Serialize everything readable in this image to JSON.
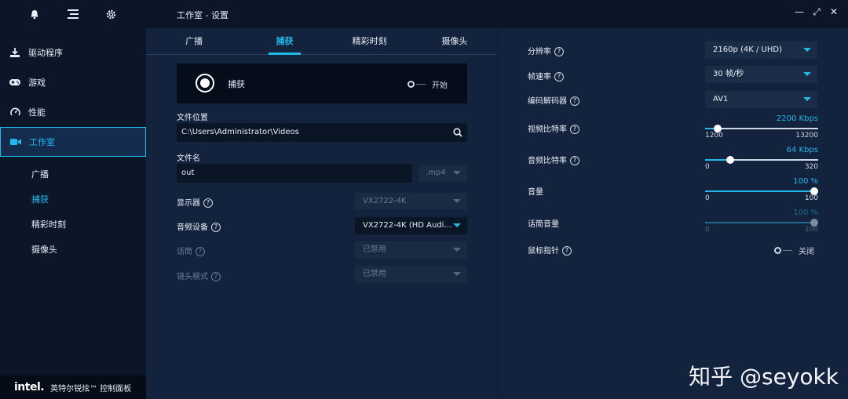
{
  "sidebar": {
    "top_icons": [
      "bell-icon",
      "menu-list-icon",
      "gear-icon"
    ],
    "items": [
      {
        "label": "驱动程序",
        "icon": "download-icon"
      },
      {
        "label": "游戏",
        "icon": "gamepad-icon"
      },
      {
        "label": "性能",
        "icon": "gauge-icon"
      },
      {
        "label": "工作室",
        "icon": "camera-icon",
        "active": true
      }
    ],
    "sub_items": [
      {
        "label": "广播"
      },
      {
        "label": "捕获",
        "active": true
      },
      {
        "label": "精彩时刻"
      },
      {
        "label": "摄像头"
      }
    ],
    "brand_logo": "intel.",
    "brand_name": "英特尔锐炫™ 控制面板"
  },
  "header": {
    "title": "工作室 - 设置",
    "window_controls": [
      "minimize-icon",
      "expand-icon",
      "close-icon"
    ]
  },
  "tabs": [
    "广播",
    "捕获",
    "精彩时刻",
    "摄像头"
  ],
  "active_tab": "捕获",
  "capture": {
    "label": "捕获",
    "toggle_label": "开始",
    "toggle_on": false
  },
  "file_location": {
    "label": "文件位置",
    "value": "C:\\Users\\Administrator\\Videos"
  },
  "file_name": {
    "label": "文件名",
    "value": "out",
    "extension": ".mp4"
  },
  "display": {
    "label": "显示器",
    "value": "VX2722-4K",
    "disabled": true
  },
  "audio_device": {
    "label": "音频设备",
    "value": "VX2722-4K (HD Audi…"
  },
  "mic": {
    "label": "话筒",
    "value": "已禁用",
    "disabled": true
  },
  "lens_mode": {
    "label": "镜头模式",
    "value": "已禁用",
    "disabled": true
  },
  "right": {
    "resolution": {
      "label": "分辨率",
      "value": "2160p (4K / UHD)"
    },
    "framerate": {
      "label": "帧速率",
      "value": "30 帧/秒"
    },
    "codec": {
      "label": "编码解码器",
      "value": "AV1"
    },
    "video_bitrate": {
      "label": "视频比特率",
      "value_text": "2200 Kbps",
      "min": "1200",
      "max": "13200",
      "value": 2200,
      "min_num": 1200,
      "max_num": 13200
    },
    "audio_bitrate": {
      "label": "音频比特率",
      "value_text": "64 Kbps",
      "min": "0",
      "max": "320",
      "value": 64,
      "min_num": 0,
      "max_num": 320
    },
    "volume": {
      "label": "音量",
      "value_text": "100 %",
      "min": "0",
      "max": "100",
      "value": 100,
      "min_num": 0,
      "max_num": 100
    },
    "mic_volume": {
      "label": "话筒音量",
      "value_text": "100 %",
      "min": "0",
      "max": "100",
      "value": 100,
      "min_num": 0,
      "max_num": 100,
      "disabled": true
    },
    "mouse_pointer": {
      "label": "鼠标指针",
      "toggle_label": "关闭",
      "toggle_on": false
    }
  },
  "watermark": "知乎 @seyokk",
  "colors": {
    "accent": "#22b8ea",
    "background": "#13233d",
    "sidebar": "#0b1628"
  }
}
